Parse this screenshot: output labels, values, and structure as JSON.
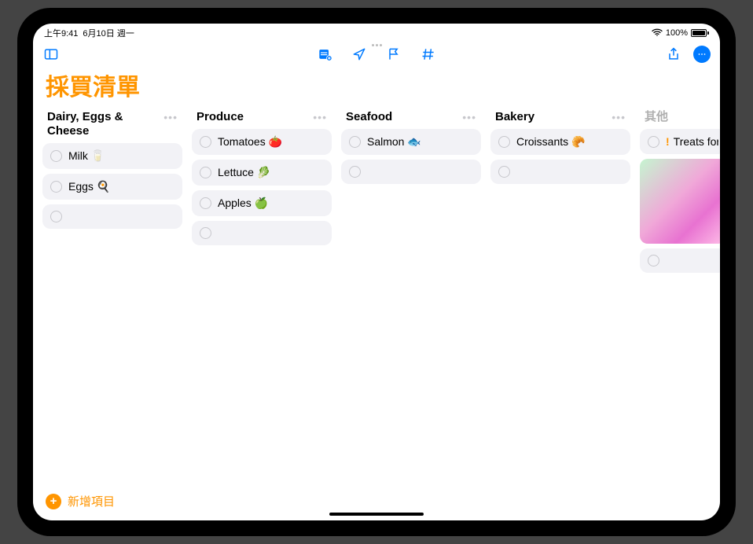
{
  "status": {
    "time": "上午9:41",
    "date": "6月10日 週一",
    "wifi": "􀙇",
    "battery_pct": "100%"
  },
  "list": {
    "title": "採買清單",
    "add_item_label": "新增項目"
  },
  "columns": [
    {
      "title": "Dairy, Eggs & Cheese",
      "items": [
        "Milk 🥛",
        "Eggs 🍳"
      ],
      "empty_rows": 1
    },
    {
      "title": "Produce",
      "items": [
        "Tomatoes 🍅",
        "Lettuce 🥬",
        "Apples 🍏"
      ],
      "empty_rows": 1
    },
    {
      "title": "Seafood",
      "items": [
        "Salmon 🐟"
      ],
      "empty_rows": 1
    },
    {
      "title": "Bakery",
      "items": [
        "Croissants 🥐"
      ],
      "empty_rows": 1
    },
    {
      "title": "其他",
      "muted": true,
      "items_priority": [
        {
          "priority": "!",
          "text": "Treats for t"
        }
      ],
      "image": true,
      "empty_rows": 1
    }
  ]
}
